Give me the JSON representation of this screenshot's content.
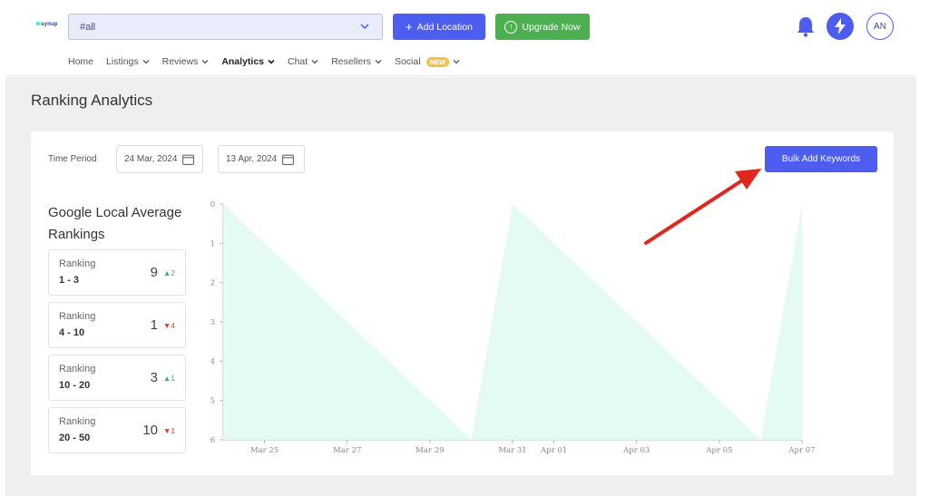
{
  "header": {
    "logo_text": "synup",
    "location_select": {
      "value": "#all"
    },
    "add_location_label": "Add Location",
    "upgrade_label": "Upgrade Now",
    "avatar_initials": "AN",
    "nav": [
      {
        "label": "Home",
        "has_caret": false,
        "active": false
      },
      {
        "label": "Listings",
        "has_caret": true,
        "active": false
      },
      {
        "label": "Reviews",
        "has_caret": true,
        "active": false
      },
      {
        "label": "Analytics",
        "has_caret": true,
        "active": true
      },
      {
        "label": "Chat",
        "has_caret": true,
        "active": false
      },
      {
        "label": "Resellers",
        "has_caret": true,
        "active": false
      },
      {
        "label": "Social",
        "has_caret": true,
        "active": false,
        "badge": "NEW"
      }
    ]
  },
  "page": {
    "title": "Ranking Analytics",
    "time_period_label": "Time Period",
    "start_date": "24 Mar, 2024",
    "end_date": "13 Apr, 2024",
    "bulk_button_label": "Bulk Add Keywords",
    "section_title": "Google Local Average Rankings",
    "rank_boxes": [
      {
        "label": "Ranking",
        "range": "1 - 3",
        "count": "9",
        "delta": "2",
        "direction": "up"
      },
      {
        "label": "Ranking",
        "range": "4 - 10",
        "count": "1",
        "delta": "4",
        "direction": "down"
      },
      {
        "label": "Ranking",
        "range": "10 - 20",
        "count": "3",
        "delta": "1",
        "direction": "up"
      },
      {
        "label": "Ranking",
        "range": "20 - 50",
        "count": "10",
        "delta": "1",
        "direction": "down"
      }
    ]
  },
  "colors": {
    "accent": "#4d5df0",
    "upgrade_green": "#4caf50",
    "area_fill": "#e4fbf2",
    "up": "#3bb273",
    "down": "#e53935",
    "annotation_arrow": "#e0261d"
  },
  "chart_data": {
    "type": "area",
    "y_ticks": [
      "0",
      "1",
      "2",
      "3",
      "4",
      "5",
      "6"
    ],
    "ylim": [
      0,
      6
    ],
    "y_inverted": true,
    "x_ticks": [
      "Mar 25",
      "Mar 27",
      "Mar 29",
      "Mar 31",
      "Apr 01",
      "Apr 03",
      "Apr 05",
      "Apr 07"
    ],
    "x": [
      "2024-03-24",
      "2024-03-30",
      "2024-03-31",
      "2024-04-06",
      "2024-04-07"
    ],
    "values": [
      0,
      6,
      0,
      6,
      0
    ],
    "xlabel": "",
    "ylabel": "",
    "title": ""
  }
}
